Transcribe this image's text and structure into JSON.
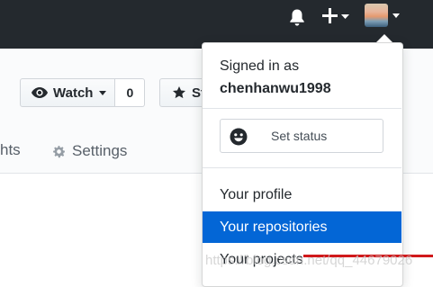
{
  "header": {
    "icons": [
      "bell-icon",
      "plus-icon",
      "avatar"
    ]
  },
  "repo": {
    "watch_label": "Watch",
    "watch_count": "0",
    "star_label": "Star",
    "tab_insights": "hts",
    "tab_settings": "Settings"
  },
  "user_menu": {
    "signed_in_label": "Signed in as",
    "username": "chenhanwu1998",
    "set_status": "Set status",
    "items": [
      {
        "label": "Your profile",
        "active": false
      },
      {
        "label": "Your repositories",
        "active": true
      },
      {
        "label": "Your projects",
        "active": false
      }
    ]
  },
  "colors": {
    "header_bg": "#24292e",
    "menu_active": "#0366d6",
    "watermark_line": "#d0191b"
  },
  "watermark": {
    "text": "https://blog.csdn.net/qq_44679026"
  }
}
